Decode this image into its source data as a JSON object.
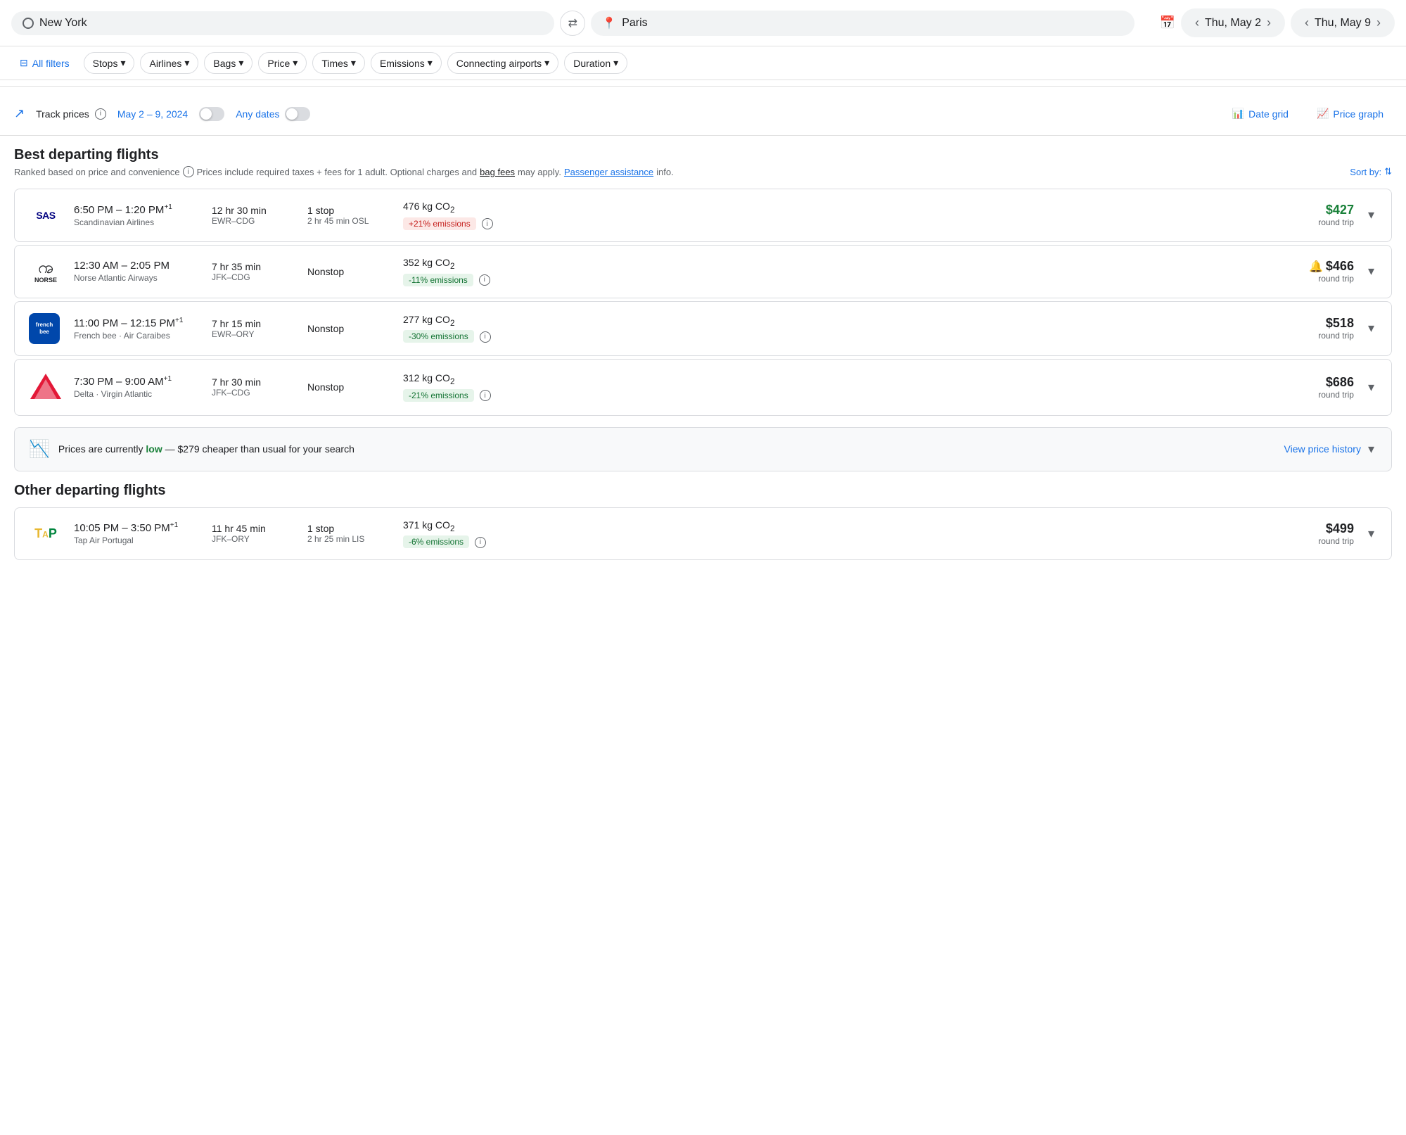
{
  "searchBar": {
    "origin": "New York",
    "destination": "Paris",
    "swapArrows": "⇄",
    "dateFrom": "Thu, May 2",
    "dateTo": "Thu, May 9",
    "calendarIcon": "📅"
  },
  "filters": {
    "allFilters": "All filters",
    "stops": "Stops",
    "airlines": "Airlines",
    "bags": "Bags",
    "price": "Price",
    "times": "Times",
    "emissions": "Emissions",
    "connectingAirports": "Connecting airports",
    "duration": "Duration"
  },
  "trackSection": {
    "trackLabel": "Track prices",
    "dateRange": "May 2 – 9, 2024",
    "anyDates": "Any dates",
    "dateGrid": "Date grid",
    "priceGraph": "Price graph"
  },
  "bestFlights": {
    "title": "Best departing flights",
    "subtitle": "Ranked based on price and convenience",
    "taxNote": "Prices include required taxes + fees for 1 adult. Optional charges and",
    "bagFees": "bag fees",
    "mayApply": "may apply.",
    "passengerAssistance": "Passenger assistance",
    "info": "info.",
    "sortBy": "Sort by:"
  },
  "flights": [
    {
      "airline": "SAS",
      "airlineFullName": "Scandinavian Airlines",
      "logoType": "sas",
      "departTime": "6:50 PM",
      "arriveTime": "1:20 PM",
      "plusDays": "+1",
      "duration": "12 hr 30 min",
      "route": "EWR–CDG",
      "stops": "1 stop",
      "stopDetail": "2 hr 45 min OSL",
      "emissions": "476 kg CO₂",
      "emissionsBadge": "+21% emissions",
      "badgeType": "red",
      "price": "$427",
      "priceColor": "green",
      "tripType": "round trip",
      "hasNotification": false
    },
    {
      "airline": "NORSE",
      "airlineFullName": "Norse Atlantic Airways",
      "logoType": "norse",
      "departTime": "12:30 AM",
      "arriveTime": "2:05 PM",
      "plusDays": "",
      "duration": "7 hr 35 min",
      "route": "JFK–CDG",
      "stops": "Nonstop",
      "stopDetail": "",
      "emissions": "352 kg CO₂",
      "emissionsBadge": "-11% emissions",
      "badgeType": "green",
      "price": "$466",
      "priceColor": "normal",
      "tripType": "round trip",
      "hasNotification": true
    },
    {
      "airline": "French Bee",
      "airlineFullName": "French Bee · Air Caraibes",
      "logoType": "frenchbee",
      "departTime": "11:00 PM",
      "arriveTime": "12:15 PM",
      "plusDays": "+1",
      "duration": "7 hr 15 min",
      "route": "EWR–ORY",
      "stops": "Nonstop",
      "stopDetail": "",
      "emissions": "277 kg CO₂",
      "emissionsBadge": "-30% emissions",
      "badgeType": "green",
      "price": "$518",
      "priceColor": "normal",
      "tripType": "round trip",
      "hasNotification": false
    },
    {
      "airline": "Delta",
      "airlineFullName": "Delta · Virgin Atlantic",
      "logoType": "delta",
      "departTime": "7:30 PM",
      "arriveTime": "9:00 AM",
      "plusDays": "+1",
      "duration": "7 hr 30 min",
      "route": "JFK–CDG",
      "stops": "Nonstop",
      "stopDetail": "",
      "emissions": "312 kg CO₂",
      "emissionsBadge": "-21% emissions",
      "badgeType": "green",
      "price": "$686",
      "priceColor": "normal",
      "tripType": "round trip",
      "hasNotification": false
    }
  ],
  "priceBanner": {
    "text": "Prices are currently",
    "level": "low",
    "savings": "— $279 cheaper than usual for your search",
    "viewHistory": "View price history"
  },
  "otherFlights": {
    "title": "Other departing flights",
    "flights": [
      {
        "airline": "TAP",
        "airlineFullName": "Tap Air Portugal",
        "logoType": "tap",
        "departTime": "10:05 PM",
        "arriveTime": "3:50 PM",
        "plusDays": "+1",
        "duration": "11 hr 45 min",
        "route": "JFK–ORY",
        "stops": "1 stop",
        "stopDetail": "2 hr 25 min LIS",
        "emissions": "371 kg CO₂",
        "emissionsBadge": "-6% emissions",
        "badgeType": "green",
        "price": "$499",
        "priceColor": "normal",
        "tripType": "round trip"
      }
    ]
  }
}
